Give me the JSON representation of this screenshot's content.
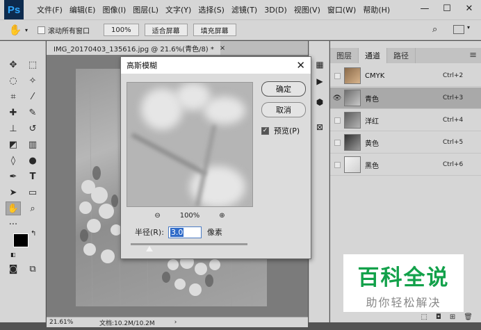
{
  "app": {
    "logo": "Ps"
  },
  "menu": [
    "文件(F)",
    "编辑(E)",
    "图像(I)",
    "图层(L)",
    "文字(Y)",
    "选择(S)",
    "滤镜(T)",
    "3D(D)",
    "视图(V)",
    "窗口(W)",
    "帮助(H)"
  ],
  "window_controls": {
    "minimize": "—",
    "maximize": "☐",
    "close": "✕"
  },
  "options": {
    "scroll_all_label": "滚动所有窗口",
    "zoom_value": "100%",
    "fit_screen": "适合屏幕",
    "fill_screen": "填充屏幕"
  },
  "document": {
    "tab_title": "IMG_20170403_135616.jpg @ 21.6%(青色/8) *",
    "close": "×"
  },
  "status": {
    "zoom": "21.61%",
    "doc_size": "文档:10.2M/10.2M",
    "arrow": "›"
  },
  "dialog": {
    "title": "高斯模糊",
    "close": "✕",
    "ok_label": "确定",
    "cancel_label": "取消",
    "preview_label": "预览(P)",
    "preview_checked": true,
    "zoom_out": "⊖",
    "zoom_in": "⊕",
    "zoom_level": "100%",
    "radius_label": "半径(R):",
    "radius_value": "3.0",
    "radius_unit": "像素",
    "slider_fraction": 0.16
  },
  "panel": {
    "tabs": [
      "图层",
      "通道",
      "路径"
    ],
    "active_tab": 1,
    "menu_icon": "≡",
    "channels": [
      {
        "name": "CMYK",
        "shortcut": "Ctrl+2",
        "visible": false,
        "selected": false
      },
      {
        "name": "青色",
        "shortcut": "Ctrl+3",
        "visible": true,
        "selected": true
      },
      {
        "name": "洋红",
        "shortcut": "Ctrl+4",
        "visible": false,
        "selected": false
      },
      {
        "name": "黄色",
        "shortcut": "Ctrl+5",
        "visible": false,
        "selected": false
      },
      {
        "name": "黑色",
        "shortcut": "Ctrl+6",
        "visible": false,
        "selected": false
      }
    ]
  },
  "watermark": {
    "title": "百科全说",
    "subtitle": "助你轻松解决"
  },
  "colors": {
    "accent": "#2e6ac8",
    "watermark_green": "#12a14a",
    "selected_channel": "#a9a9a9"
  }
}
